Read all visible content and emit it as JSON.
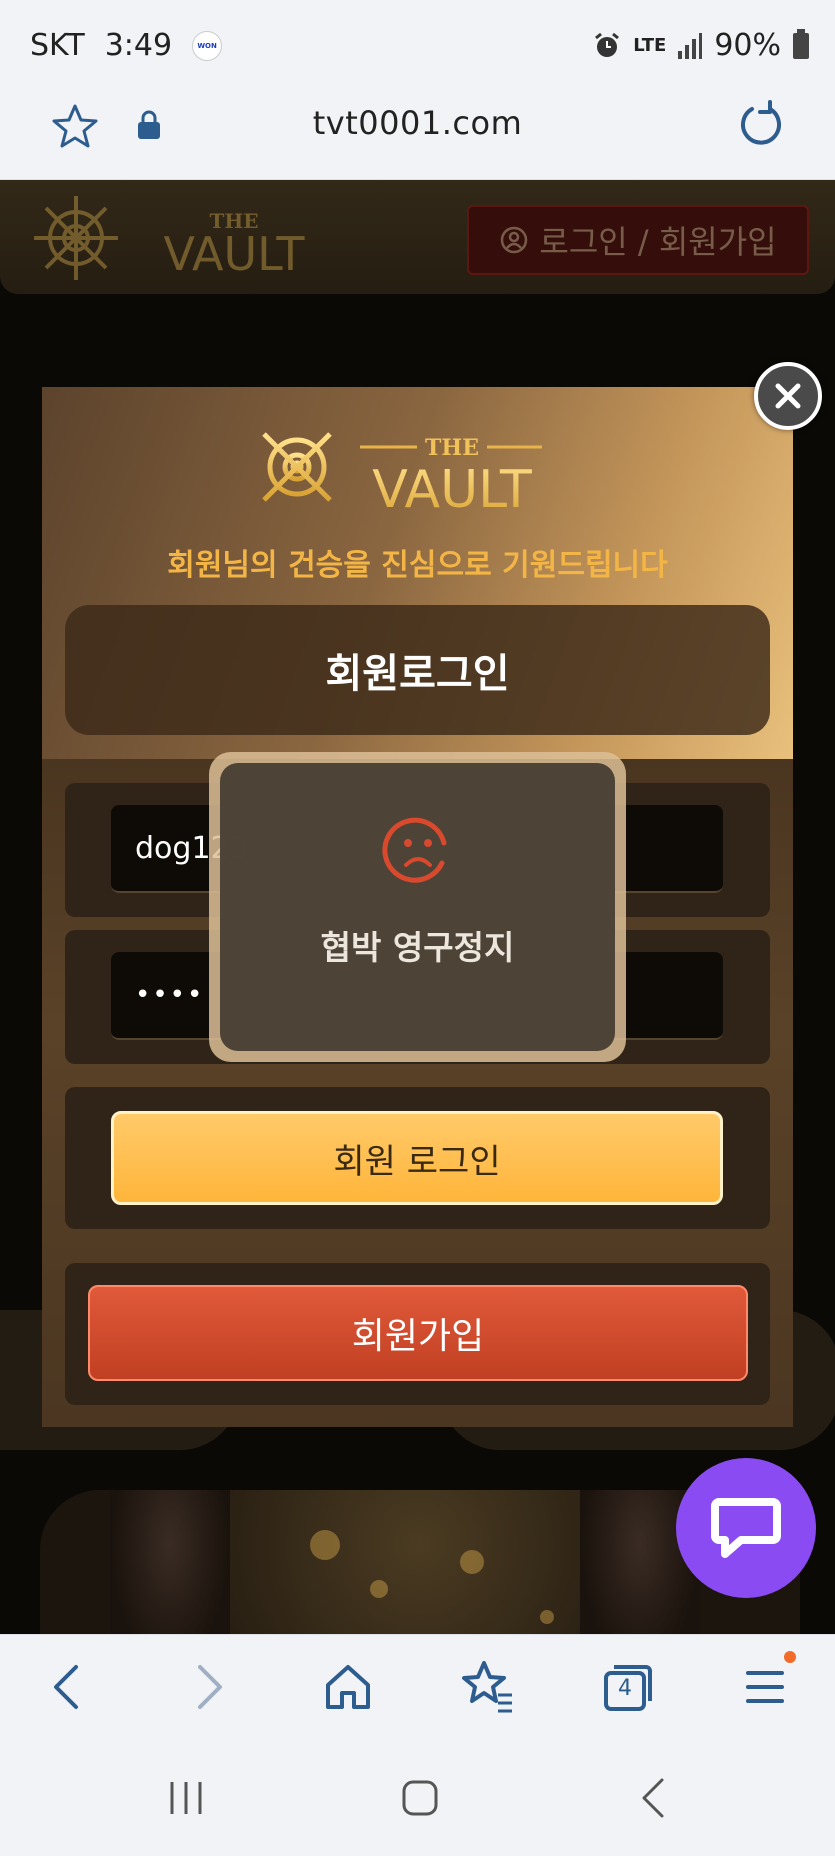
{
  "status_bar": {
    "carrier": "SKT",
    "time": "3:49",
    "app_badge": "WON",
    "network": "LTE",
    "battery": "90%"
  },
  "browser": {
    "url": "tvt0001.com",
    "tab_count": "4"
  },
  "site": {
    "logo_text": "THE VAULT",
    "header_login_button": "로그인 / 회원가입"
  },
  "modal": {
    "logo_text": "THE VAULT",
    "subtitle": "회원님의 건승을 진심으로 기원드립니다",
    "title": "회원로그인",
    "id_value": "dog123",
    "password_masked": "••••",
    "login_button": "회원 로그인",
    "join_button": "회원가입"
  },
  "toast": {
    "icon": "sad-face-icon",
    "message": "협박 영구정지"
  },
  "colors": {
    "gold": "#f3b646",
    "login_btn": "#ffbf4d",
    "join_btn": "#d54c2e",
    "chat": "#8a4cf2",
    "browser_icon": "#2d5c8f"
  }
}
